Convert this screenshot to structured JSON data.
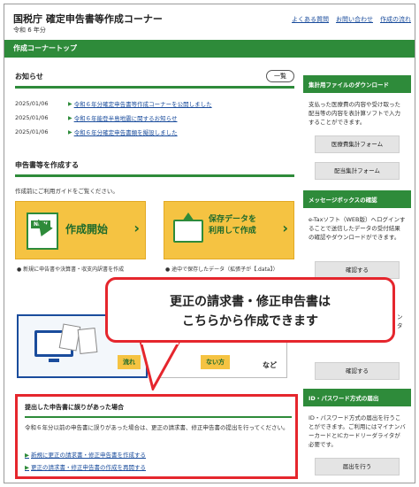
{
  "header": {
    "title": "国税庁 確定申告書等作成コーナー",
    "subtitle": "令和 6 年分",
    "links": [
      "よくある質問",
      "お問い合わせ",
      "作成の流れ"
    ]
  },
  "greenbar": {
    "label": "作成コーナートップ"
  },
  "news": {
    "title": "お知らせ",
    "list_button": "一覧",
    "items": [
      {
        "date": "2025/01/06",
        "text": "令和６年分確定申告書等作成コーナーを公開しました"
      },
      {
        "date": "2025/01/06",
        "text": "令和６年能登半島地震に関するお知らせ"
      },
      {
        "date": "2025/01/06",
        "text": "令和６年分確定申告書類を擬設しました"
      }
    ]
  },
  "create": {
    "title": "申告書等を作成する",
    "hint": "作成前にご利用ガイドをご覧ください。",
    "tile1": {
      "badge": "NEW",
      "label": "作成開始",
      "note": "● 新規に申告書や決算書・収支内訳書を作成"
    },
    "tile2": {
      "label_line1": "保存データを",
      "label_line2": "利用して作成",
      "note": "● 途中で保存したデータ（拡張子が【.data】）"
    },
    "lower_yellow1": "流れ",
    "lower_yellow2": "ない方",
    "lower_nado": "など"
  },
  "callout": {
    "line1": "更正の請求書・修正申告書は",
    "line2": "こちらから作成できます"
  },
  "correction": {
    "title": "提出した申告書に誤りがあった場合",
    "body": "令和６年分以前の申告書に誤りがあった場合は、更正の請求書、修正申告書の提出を行ってください。",
    "link1": "新規に更正の請求書・修正申告書を作成する",
    "link2": "更正の請求書・修正申告書の作成を再開する"
  },
  "sidebar": {
    "box1": {
      "title": "集計用ファイルのダウンロード",
      "text": "支払った医療費の内容や受け取った配当等の内容を表計算ソフトで入力することができます。",
      "buttons": [
        "医療費集計フォーム",
        "配当集計フォーム"
      ]
    },
    "box2": {
      "title": "メッセージボックスの確認",
      "text": "e-Taxソフト（WEB版）へログインすることで送信したデータの受付結果の確認やダウンロードができます。",
      "button": "確認する"
    },
    "box3": {
      "partial": "ン\nタ",
      "button": "確認する"
    },
    "box4": {
      "title": "ID・パスワード方式の届出",
      "text": "ID・パスワード方式の届出を行うことができます。ご利用にはマイナンバーカードとICカードリーダライタが必要です。",
      "button": "届出を行う"
    }
  },
  "colors": {
    "green": "#2e8b3a",
    "red": "#e5262d",
    "tile": "#f5c342",
    "link": "#1a4c9c"
  }
}
